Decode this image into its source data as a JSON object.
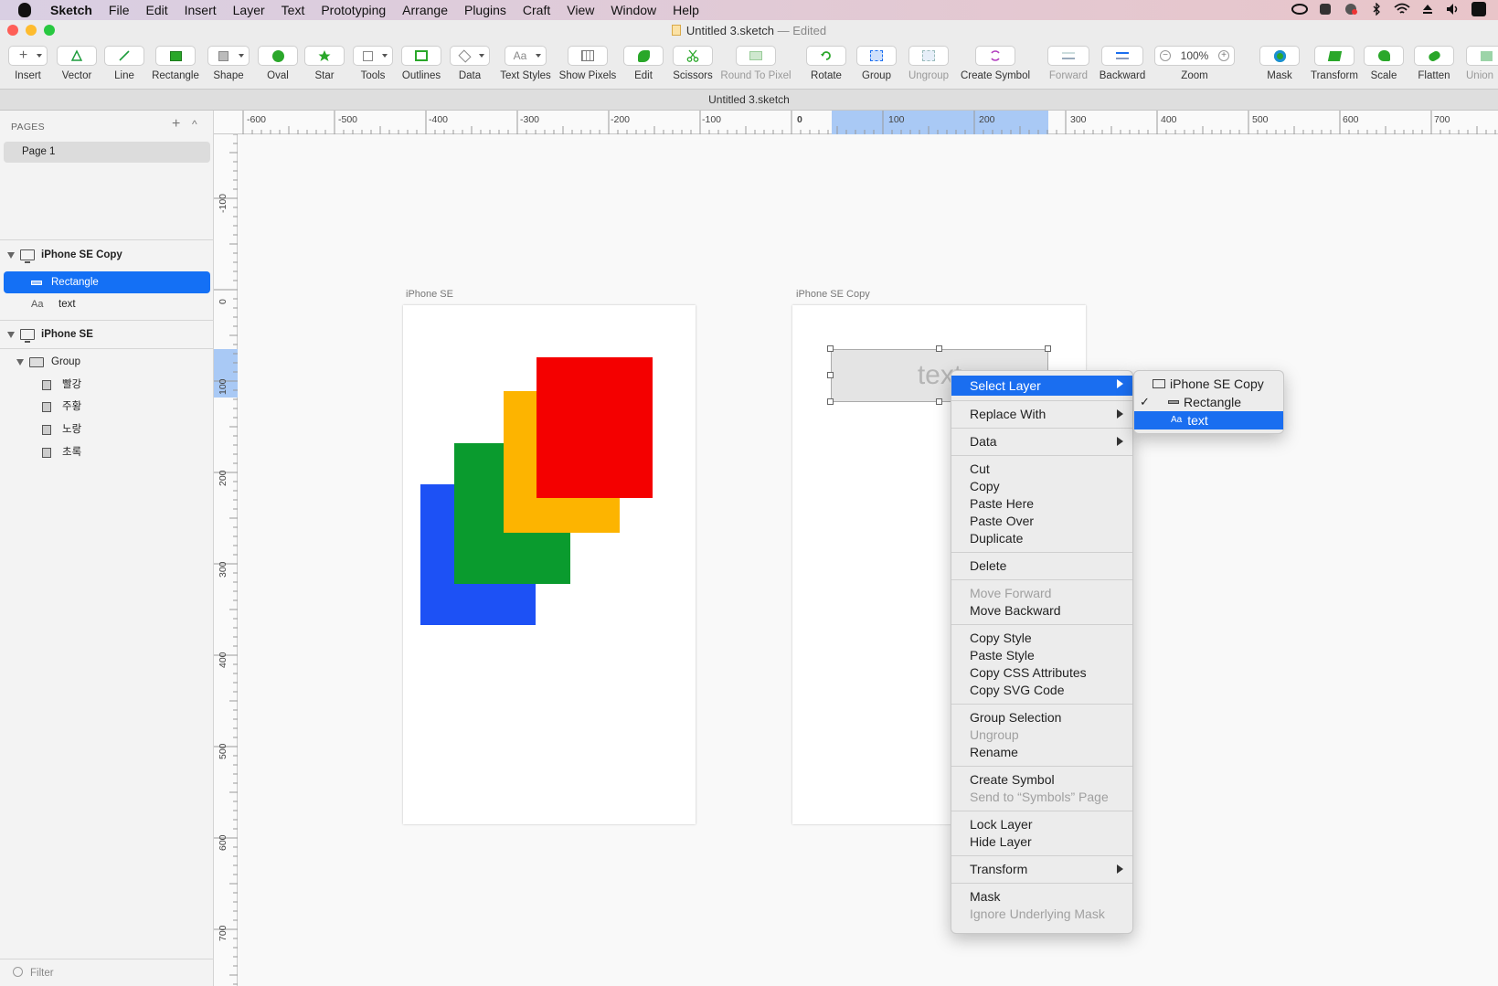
{
  "menubar": {
    "app": "Sketch",
    "items": [
      "File",
      "Edit",
      "Insert",
      "Layer",
      "Text",
      "Prototyping",
      "Arrange",
      "Plugins",
      "Craft",
      "View",
      "Window",
      "Help"
    ]
  },
  "window": {
    "title": "Untitled 3.sketch",
    "edited": "— Edited",
    "doc_tab": "Untitled 3.sketch"
  },
  "toolbar": {
    "insert": "Insert",
    "vector": "Vector",
    "line": "Line",
    "rectangle": "Rectangle",
    "shape": "Shape",
    "oval": "Oval",
    "star": "Star",
    "tools": "Tools",
    "outlines": "Outlines",
    "data": "Data",
    "text_styles": "Text Styles",
    "text_styles_btn": "Aa",
    "show_pixels": "Show Pixels",
    "edit": "Edit",
    "scissors": "Scissors",
    "round_to_pixel": "Round To Pixel",
    "rotate": "Rotate",
    "group": "Group",
    "ungroup": "Ungroup",
    "create_symbol": "Create Symbol",
    "forward": "Forward",
    "backward": "Backward",
    "zoom": "Zoom",
    "zoom_value": "100%",
    "zoom_minus": "−",
    "zoom_plus": "+",
    "mask": "Mask",
    "transform": "Transform",
    "scale": "Scale",
    "flatten": "Flatten",
    "union": "Union"
  },
  "pages": {
    "header": "PAGES",
    "add": "+",
    "collapse": "^",
    "items": [
      "Page 1"
    ]
  },
  "layers": {
    "artboard_copy": "iPhone SE Copy",
    "rectangle": "Rectangle",
    "text_icon": "Aa",
    "text": "text",
    "artboard": "iPhone SE",
    "group": "Group",
    "group_items": [
      "빨강",
      "주황",
      "노랑",
      "초록"
    ]
  },
  "filter": {
    "placeholder": "Filter"
  },
  "ruler": {
    "h": [
      "-600",
      "-500",
      "-400",
      "-300",
      "-200",
      "-100",
      "0",
      "100",
      "200",
      "300",
      "400",
      "500",
      "600",
      "700"
    ],
    "v": [
      "-100",
      "0",
      "100",
      "200",
      "300",
      "400",
      "500",
      "600",
      "700"
    ]
  },
  "canvas": {
    "artboard1_label": "iPhone SE",
    "artboard2_label": "iPhone SE Copy",
    "selected_text": "text",
    "colors": {
      "red": "#f40000",
      "orange": "#fdb400",
      "green": "#0a9b2e",
      "blue": "#1d51f5"
    }
  },
  "context_menu": {
    "select_layer": "Select Layer",
    "replace_with": "Replace With",
    "data": "Data",
    "cut": "Cut",
    "copy": "Copy",
    "paste_here": "Paste Here",
    "paste_over": "Paste Over",
    "duplicate": "Duplicate",
    "delete": "Delete",
    "move_forward": "Move Forward",
    "move_backward": "Move Backward",
    "copy_style": "Copy Style",
    "paste_style": "Paste Style",
    "copy_css": "Copy CSS Attributes",
    "copy_svg": "Copy SVG Code",
    "group_selection": "Group Selection",
    "ungroup": "Ungroup",
    "rename": "Rename",
    "create_symbol": "Create Symbol",
    "send_to_symbols": "Send to “Symbols” Page",
    "lock_layer": "Lock Layer",
    "hide_layer": "Hide Layer",
    "transform": "Transform",
    "mask": "Mask",
    "ignore_mask": "Ignore Underlying Mask"
  },
  "submenu": {
    "artboard": "iPhone SE Copy",
    "rectangle": "Rectangle",
    "text_icon": "Aa",
    "text": "text",
    "check": "✓"
  }
}
